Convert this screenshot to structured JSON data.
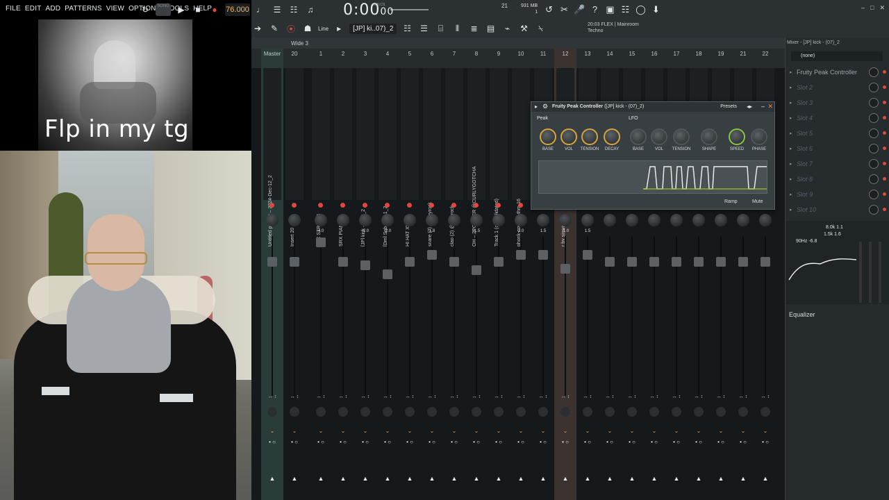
{
  "menu": [
    "FILE",
    "EDIT",
    "ADD",
    "PATTERNS",
    "VIEW",
    "OPTIONS",
    "TOOLS",
    "HELP"
  ],
  "transport": {
    "song_mode": "SONG",
    "tempo": "76.000",
    "time": "0:00",
    "time_small": "00",
    "time_unit": "M:S:CS",
    "pattern_num": "21",
    "memory": "931 MB",
    "cpu": "1"
  },
  "toolbar2": {
    "line_mode": "Line",
    "pattern": "[JP] ki..07)_2",
    "hint_line1": "20:03  FLEX | Mainroom",
    "hint_line2": "Techno"
  },
  "mixer": {
    "title": "Wide 3",
    "strips": [
      {
        "num": "Master",
        "name": "Untitled project – 2024-Dec-12_2",
        "pan": "",
        "type": "master"
      },
      {
        "num": "20",
        "name": "Insert 20",
        "pan": ""
      },
      {
        "num": "1",
        "name": "SRX STRINGS",
        "pan": "4.0"
      },
      {
        "num": "2",
        "name": "SRX PIANO 1",
        "pan": ""
      },
      {
        "num": "3",
        "name": "[JP] kick – (07)_2",
        "pan": "-2.0"
      },
      {
        "num": "4",
        "name": "[Dm] Sub thug 1_2",
        "pan": "-2.0"
      },
      {
        "num": "5",
        "name": "HI HAT XV (9)",
        "pan": ""
      },
      {
        "num": "6",
        "name": "snare (7) @greyrock",
        "pan": "1.8"
      },
      {
        "num": "7",
        "name": "clap (2) @greyrock",
        "pan": ""
      },
      {
        "num": "8",
        "name": "OH – 2POINTER @CURLYGOTCHA",
        "pan": "-1.5"
      },
      {
        "num": "9",
        "name": "Track 1 (consolidated)",
        "pan": ""
      },
      {
        "num": "10",
        "name": "phonk-cowbell-thm-16",
        "pan": "2.0"
      },
      {
        "num": "11",
        "name": "",
        "pan": "1.5"
      },
      {
        "num": "12",
        "name": "r by sinwa",
        "pan": "-1.0",
        "type": "selected"
      },
      {
        "num": "13",
        "name": "",
        "pan": "1.5"
      },
      {
        "num": "14",
        "name": "",
        "pan": ""
      },
      {
        "num": "15",
        "name": "",
        "pan": ""
      },
      {
        "num": "16",
        "name": "",
        "pan": ""
      },
      {
        "num": "17",
        "name": "",
        "pan": ""
      },
      {
        "num": "18",
        "name": "",
        "pan": ""
      },
      {
        "num": "19",
        "name": "",
        "pan": ""
      },
      {
        "num": "21",
        "name": "",
        "pan": ""
      },
      {
        "num": "22",
        "name": "",
        "pan": ""
      }
    ]
  },
  "plugin": {
    "title": "Fruity Peak Controller",
    "subtitle": "([JP] kick - (07)_2)",
    "presets": "Presets",
    "peak_label": "Peak",
    "lfo_label": "LFO",
    "peak_knobs": [
      "BASE",
      "VOL",
      "TENSION",
      "DECAY"
    ],
    "lfo_knobs": [
      "BASE",
      "VOL",
      "TENSION",
      "SHAPE",
      "SPEED",
      "PHASE"
    ],
    "ramp": "Ramp",
    "mute": "Mute"
  },
  "rack": {
    "title": "Mixer - [JP] kick - (07)_2",
    "input": "(none)",
    "slots": [
      "Fruity Peak Controller",
      "Slot 2",
      "Slot 3",
      "Slot 4",
      "Slot 5",
      "Slot 6",
      "Slot 7",
      "Slot 8",
      "Slot 9",
      "Slot 10"
    ],
    "eq_label": "Equalizer",
    "eq_values": [
      "8.0k 1.1",
      "1.5k 1.6",
      "90Hz -6.8"
    ]
  },
  "overlay": {
    "caption": "Flp in my tg"
  },
  "colors": {
    "accent": "#d9a53b",
    "green": "#8cc43f",
    "record": "#d94b3f",
    "master_strip": "#2a3c3a"
  }
}
